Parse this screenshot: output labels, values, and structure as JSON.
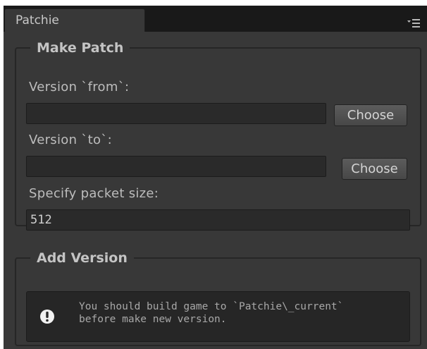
{
  "tab": {
    "title": "Patchie",
    "menu_icon": "context-menu-icon"
  },
  "make_patch": {
    "title": "Make Patch",
    "from_label": "Version `from`:",
    "from_value": "",
    "to_label": "Version `to`:",
    "to_value": "",
    "choose_label": "Choose",
    "packet_label": "Specify packet size:",
    "packet_value": "512"
  },
  "add_version": {
    "title": "Add Version",
    "icon": "info-icon",
    "message": "You should build game to `Patchie\\_current`\nbefore make new version."
  },
  "colors": {
    "panel_bg": "#383838",
    "field_bg": "#2a2a2a",
    "text": "#bdbdbd"
  }
}
